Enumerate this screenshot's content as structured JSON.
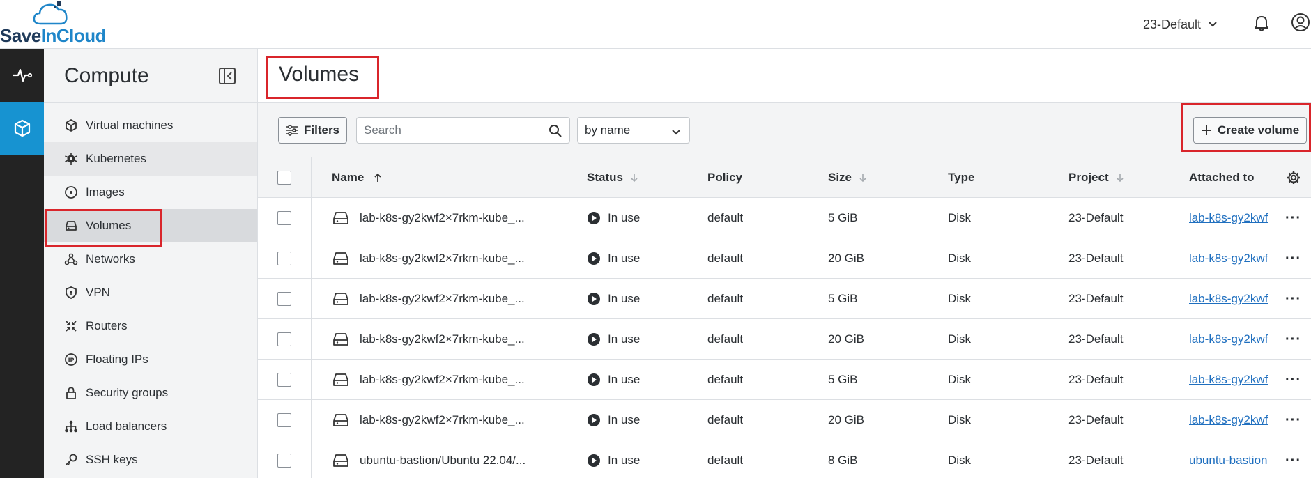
{
  "brand": {
    "logo_prefix": "Save",
    "logo_suffix": "InCloud"
  },
  "topbar": {
    "project_label": "23-Default"
  },
  "sidebar": {
    "title": "Compute",
    "items": [
      {
        "label": "Virtual machines",
        "icon": "cube-icon"
      },
      {
        "label": "Kubernetes",
        "icon": "kubernetes-icon"
      },
      {
        "label": "Images",
        "icon": "disc-icon"
      },
      {
        "label": "Volumes",
        "icon": "drive-icon"
      },
      {
        "label": "Networks",
        "icon": "network-icon"
      },
      {
        "label": "VPN",
        "icon": "shield-icon"
      },
      {
        "label": "Routers",
        "icon": "router-icon"
      },
      {
        "label": "Floating IPs",
        "icon": "ip-icon"
      },
      {
        "label": "Security groups",
        "icon": "lock-icon"
      },
      {
        "label": "Load balancers",
        "icon": "load-balancer-icon"
      },
      {
        "label": "SSH keys",
        "icon": "key-icon"
      }
    ]
  },
  "page": {
    "title": "Volumes"
  },
  "toolbar": {
    "filters_label": "Filters",
    "search_placeholder": "Search",
    "sort_value": "by name",
    "create_label": "Create volume"
  },
  "table": {
    "headers": {
      "name": "Name",
      "status": "Status",
      "policy": "Policy",
      "size": "Size",
      "type": "Type",
      "project": "Project",
      "attached": "Attached to"
    },
    "rows": [
      {
        "name": "lab-k8s-gy2kwf2×7rkm-kube_...",
        "status": "In use",
        "policy": "default",
        "size": "5 GiB",
        "type": "Disk",
        "project": "23-Default",
        "attached": "lab-k8s-gy2kwf"
      },
      {
        "name": "lab-k8s-gy2kwf2×7rkm-kube_...",
        "status": "In use",
        "policy": "default",
        "size": "20 GiB",
        "type": "Disk",
        "project": "23-Default",
        "attached": "lab-k8s-gy2kwf"
      },
      {
        "name": "lab-k8s-gy2kwf2×7rkm-kube_...",
        "status": "In use",
        "policy": "default",
        "size": "5 GiB",
        "type": "Disk",
        "project": "23-Default",
        "attached": "lab-k8s-gy2kwf"
      },
      {
        "name": "lab-k8s-gy2kwf2×7rkm-kube_...",
        "status": "In use",
        "policy": "default",
        "size": "20 GiB",
        "type": "Disk",
        "project": "23-Default",
        "attached": "lab-k8s-gy2kwf"
      },
      {
        "name": "lab-k8s-gy2kwf2×7rkm-kube_...",
        "status": "In use",
        "policy": "default",
        "size": "5 GiB",
        "type": "Disk",
        "project": "23-Default",
        "attached": "lab-k8s-gy2kwf"
      },
      {
        "name": "lab-k8s-gy2kwf2×7rkm-kube_...",
        "status": "In use",
        "policy": "default",
        "size": "20 GiB",
        "type": "Disk",
        "project": "23-Default",
        "attached": "lab-k8s-gy2kwf"
      },
      {
        "name": "ubuntu-bastion/Ubuntu 22.04/...",
        "status": "In use",
        "policy": "default",
        "size": "8 GiB",
        "type": "Disk",
        "project": "23-Default",
        "attached": "ubuntu-bastion"
      }
    ]
  },
  "colors": {
    "accent": "#1793d1",
    "highlight": "#d9252b",
    "rail": "#232323",
    "link": "#1f6fbf"
  }
}
